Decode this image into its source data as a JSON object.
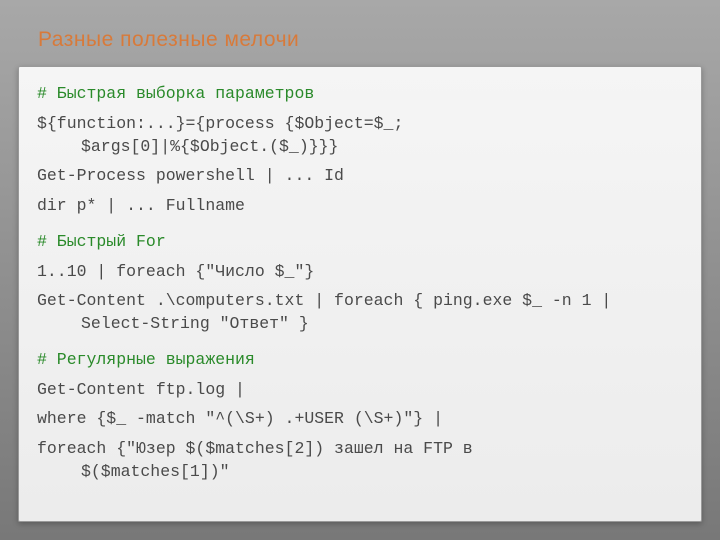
{
  "title": "Разные полезные мелочи",
  "code": {
    "c1": "# Быстрая выборка параметров",
    "l1": "${function:...}={process {$Object=$_;",
    "l1b": "$args[0]|%{$Object.($_)}}}",
    "l2": "Get-Process powershell | ... Id",
    "l3": "dir p* | ... Fullname",
    "c2": "# Быстрый For",
    "l4": "1..10 | foreach {\"Число $_\"}",
    "l5": "Get-Content .\\computers.txt | foreach { ping.exe $_ -n 1 |",
    "l5b": "Select-String \"Ответ\" }",
    "c3": "# Регулярные выражения",
    "l6": "Get-Content ftp.log |",
    "l7": "where {$_ -match \"^(\\S+) .+USER (\\S+)\"} |",
    "l8": "foreach {\"Юзер $($matches[2]) зашел на FTP в",
    "l8b": "$($matches[1])\""
  }
}
